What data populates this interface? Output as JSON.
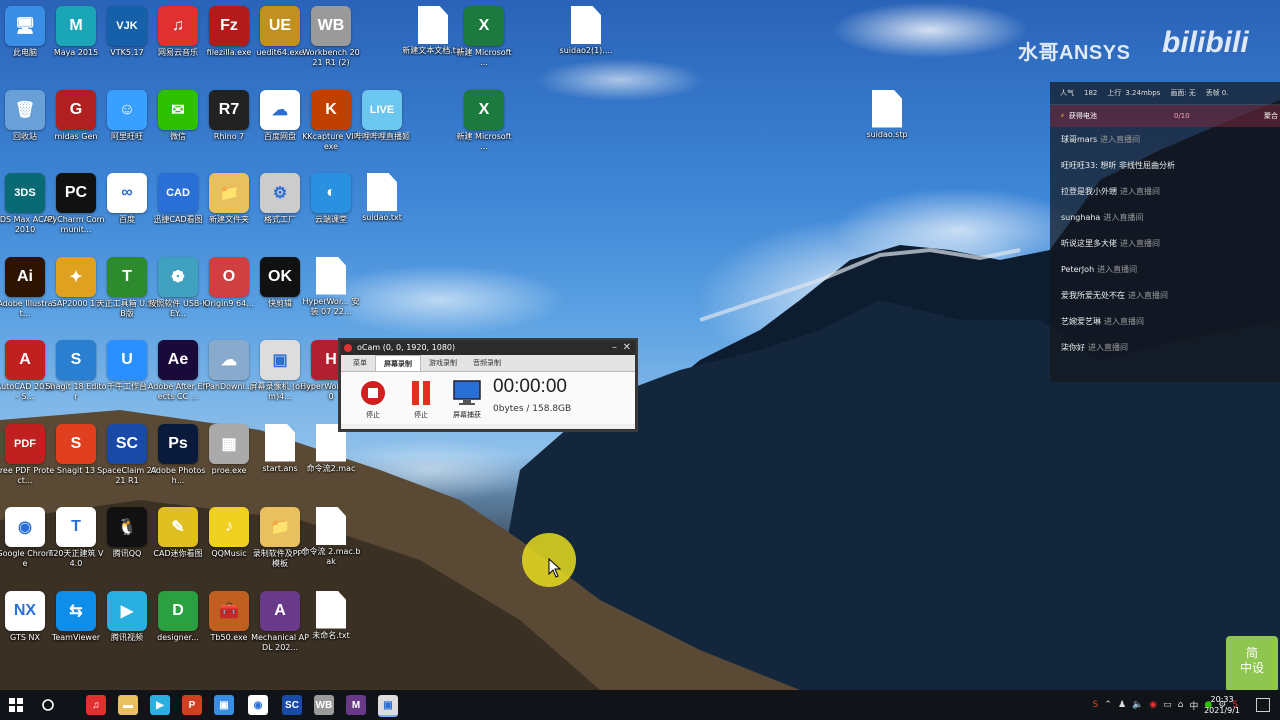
{
  "watermark": {
    "text": "水哥ANSYS",
    "brand": "bilibili"
  },
  "desktop_icons": [
    {
      "label": "此电脑",
      "color": "#3a8ee6",
      "glyph": "🖥"
    },
    {
      "label": "Maya 2015",
      "color": "#1aa6b7",
      "glyph": "M"
    },
    {
      "label": "VTK5.17",
      "color": "#1560a8",
      "glyph": "VJK"
    },
    {
      "label": "网易云音乐",
      "color": "#e03030",
      "glyph": "♫"
    },
    {
      "label": "filezilla.exe",
      "color": "#b31b1b",
      "glyph": "Fz"
    },
    {
      "label": "uedit64.exe",
      "color": "#c09020",
      "glyph": "UE"
    },
    {
      "label": "Workbench 2021 R1 (2)",
      "color": "#9a9a9a",
      "glyph": "WB"
    },
    {
      "label": "新建文本文档.txt",
      "file": true
    },
    {
      "label": "新建 Microsoft ...",
      "color": "#1d7a3e",
      "glyph": "X"
    },
    {
      "label": "suidao2(1)....",
      "file": true
    },
    {
      "label": "回收站",
      "color": "#6aa0d8",
      "glyph": "🗑"
    },
    {
      "label": "midas Gen",
      "color": "#b02020",
      "glyph": "G"
    },
    {
      "label": "阿里旺旺",
      "color": "#3aa0ff",
      "glyph": "☺"
    },
    {
      "label": "微信",
      "color": "#2dc100",
      "glyph": "✉"
    },
    {
      "label": "Rhino 7",
      "color": "#222",
      "glyph": "R7"
    },
    {
      "label": "百度网盘",
      "color": "#fff",
      "glyph": "☁"
    },
    {
      "label": "KKcapture VIP.exe",
      "color": "#c04000",
      "glyph": "K"
    },
    {
      "label": "哔哩哔哩直播姬",
      "color": "#6cc7f0",
      "glyph": "LIVE"
    },
    {
      "label": "新建 Microsoft ...",
      "color": "#1d7a3e",
      "glyph": "X"
    },
    {
      "label": "suidao.stp",
      "file": true
    },
    {
      "label": "3DS Max ACAD2010",
      "color": "#0a6a74",
      "glyph": "3DS"
    },
    {
      "label": "PyCharm Communit...",
      "color": "#111",
      "glyph": "PC"
    },
    {
      "label": "百度",
      "color": "#fff",
      "glyph": "∞"
    },
    {
      "label": "迅捷CAD看图",
      "color": "#2a6fd6",
      "glyph": "CAD"
    },
    {
      "label": "新建文件夹",
      "color": "#e8c060",
      "glyph": "📁"
    },
    {
      "label": "格式工厂",
      "color": "#ccc",
      "glyph": "⚙"
    },
    {
      "label": "云端课堂",
      "color": "#2a90e0",
      "glyph": "◐"
    },
    {
      "label": "suidao.txt",
      "file": true
    },
    {
      "label": "Adobe Illustrat...",
      "color": "#2d1400",
      "glyph": "Ai"
    },
    {
      "label": "SAP2000 17",
      "color": "#e0a020",
      "glyph": "✦"
    },
    {
      "label": "天正工具箱 U.SPB版",
      "color": "#2d8a2d",
      "glyph": "T"
    },
    {
      "label": "按照软件 USB-KEY...",
      "color": "#40a0c0",
      "glyph": "❁"
    },
    {
      "label": "Origin9 64...",
      "color": "#d04040",
      "glyph": "O"
    },
    {
      "label": "快剪辑",
      "color": "#111",
      "glyph": "OK"
    },
    {
      "label": "HyperWor... 安装 07 22...",
      "file": true
    },
    {
      "label": "AutoCAD 2010 - S...",
      "color": "#c02020",
      "glyph": "A"
    },
    {
      "label": "Snagit 18 Editor",
      "color": "#2a7fd0",
      "glyph": "S"
    },
    {
      "label": "千牛工作台",
      "color": "#2a90ff",
      "glyph": "U"
    },
    {
      "label": "Adobe After Effects CC ...",
      "color": "#1a0a3a",
      "glyph": "Ae"
    },
    {
      "label": "PanDownl...",
      "color": "#8ac",
      "glyph": "☁"
    },
    {
      "label": "屏幕录像机 (oCam)4...",
      "color": "#ddd",
      "glyph": "▣"
    },
    {
      "label": "HyperWor... 18.0",
      "color": "#b02030",
      "glyph": "H"
    },
    {
      "label": "Free PDF Protect...",
      "color": "#c02020",
      "glyph": "PDF"
    },
    {
      "label": "Snagit 13",
      "color": "#e04020",
      "glyph": "S"
    },
    {
      "label": "SpaceClaim 2021 R1",
      "color": "#1a4aa8",
      "glyph": "SC"
    },
    {
      "label": "Adobe Photosh...",
      "color": "#0a1a3a",
      "glyph": "Ps"
    },
    {
      "label": "proe.exe",
      "color": "#aaa",
      "glyph": "▦"
    },
    {
      "label": "start.ans",
      "file": true
    },
    {
      "label": "命令流2.mac",
      "file": true
    },
    {
      "label": "Google Chrome",
      "color": "#fff",
      "glyph": "◉"
    },
    {
      "label": "T20天正建筑 V4.0",
      "color": "#fff",
      "glyph": "T"
    },
    {
      "label": "腾讯QQ",
      "color": "#111",
      "glyph": "🐧"
    },
    {
      "label": "CAD迷你看图",
      "color": "#e0c020",
      "glyph": "✎"
    },
    {
      "label": "QQMusic",
      "color": "#f0d020",
      "glyph": "♪"
    },
    {
      "label": "录制软件及PPT模板",
      "color": "#e8c060",
      "glyph": "📁"
    },
    {
      "label": "命令流 2.mac.bak",
      "file": true
    },
    {
      "label": "GTS NX",
      "color": "#fff",
      "glyph": "NX"
    },
    {
      "label": "TeamViewer",
      "color": "#0e8ee9",
      "glyph": "⇆"
    },
    {
      "label": "腾讯视频",
      "color": "#2ab0e0",
      "glyph": "▶"
    },
    {
      "label": "designer...",
      "color": "#2aa040",
      "glyph": "D"
    },
    {
      "label": "Tb50.exe",
      "color": "#c06020",
      "glyph": "🧰"
    },
    {
      "label": "Mechanical APDL 202...",
      "color": "#6a3a8a",
      "glyph": "A"
    },
    {
      "label": "未命名.txt",
      "file": true
    }
  ],
  "ocam": {
    "title": "oCam (0, 0, 1920, 1080)",
    "tabs": [
      "菜单",
      "屏幕录制",
      "游戏录制",
      "音频录制"
    ],
    "buttons": [
      "停止",
      "停止",
      "屏幕捕获"
    ],
    "timer": "00:00:00",
    "size": "0bytes / 158.8GB"
  },
  "live": {
    "stats": {
      "popularity_label": "人气",
      "popularity": "182",
      "upload_label": "上行",
      "upload": "3.24mbps",
      "quality_label": "画面:",
      "quality": "无",
      "frame_label": "丢帧",
      "frame": "0."
    },
    "task": {
      "label": "获得电池",
      "progress": "0/10",
      "right": "聚合"
    },
    "messages": [
      {
        "user": "球哥mars",
        "text": "进入直播间"
      },
      {
        "user": "旺旺旺33: 想听 非线性屈曲分析",
        "text": ""
      },
      {
        "user": "拉登是我小外甥",
        "text": "进入直播间"
      },
      {
        "user": "sunghaha",
        "text": "进入直播间"
      },
      {
        "user": "听说这里多大佬",
        "text": "进入直播间"
      },
      {
        "user": "PeterJoh",
        "text": "进入直播间"
      },
      {
        "user": "爱我所爱无处不在",
        "text": "进入直播间"
      },
      {
        "user": "艺婉爱艺琳",
        "text": "进入直播间"
      },
      {
        "user": "柒你好",
        "text": "进入直播间"
      }
    ]
  },
  "badge": {
    "line1": "简",
    "line2": "中设"
  },
  "taskbar": {
    "apps": [
      {
        "name": "netease",
        "color": "#e03030",
        "glyph": "♫"
      },
      {
        "name": "explorer",
        "color": "#e8c060",
        "glyph": "▬"
      },
      {
        "name": "tencent-video",
        "color": "#2ab0e0",
        "glyph": "▶"
      },
      {
        "name": "powerpoint",
        "color": "#d04020",
        "glyph": "P"
      },
      {
        "name": "screen-capture",
        "color": "#3a8ee6",
        "glyph": "▣"
      },
      {
        "name": "chrome",
        "color": "#fff",
        "glyph": "◉"
      },
      {
        "name": "spaceclaim",
        "color": "#1a4aa8",
        "glyph": "SC"
      },
      {
        "name": "workbench",
        "color": "#9a9a9a",
        "glyph": "WB"
      },
      {
        "name": "mechanical",
        "color": "#6a3a8a",
        "glyph": "M"
      },
      {
        "name": "ocam",
        "color": "#ddd",
        "glyph": "▣"
      }
    ],
    "ime": "中",
    "time": "20:33",
    "date": "2021/9/1"
  }
}
